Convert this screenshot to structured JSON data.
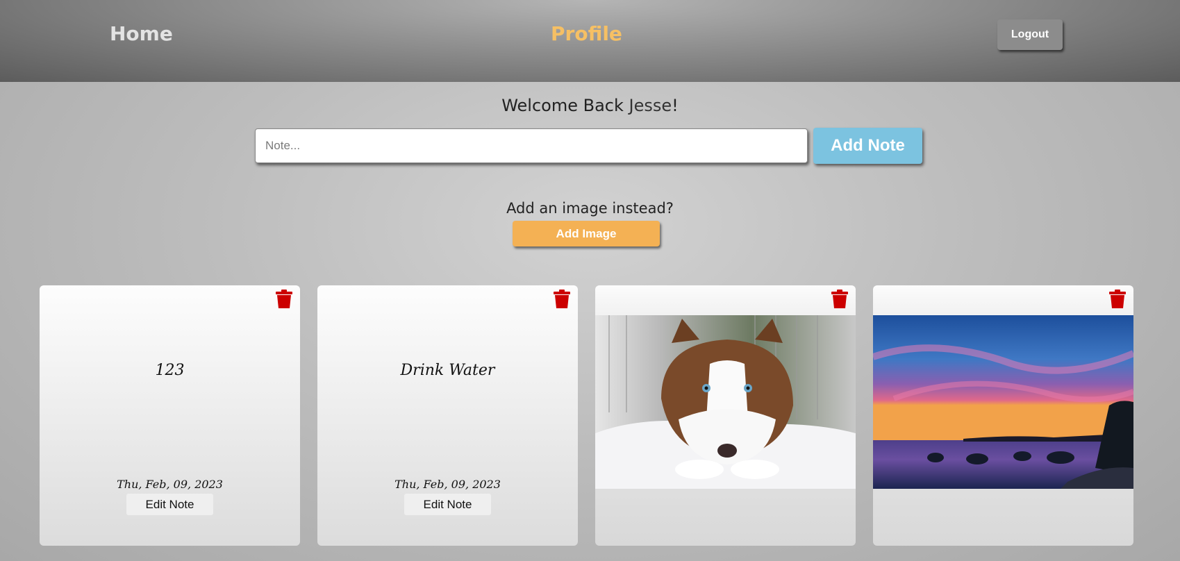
{
  "nav": {
    "home": "Home",
    "profile": "Profile",
    "logout": "Logout"
  },
  "welcome": {
    "greeting": "Welcome Back",
    "user": "Jesse",
    "suffix": "!"
  },
  "note_form": {
    "placeholder": "Note...",
    "submit": "Add Note"
  },
  "image_form": {
    "prompt": "Add an image instead?",
    "submit": "Add Image"
  },
  "cards": [
    {
      "type": "note",
      "text": "123",
      "date": "Thu, Feb, 09, 2023",
      "edit": "Edit Note"
    },
    {
      "type": "note",
      "text": "Drink Water",
      "date": "Thu, Feb, 09, 2023",
      "edit": "Edit Note"
    },
    {
      "type": "image",
      "content": "husky lying in snow photo"
    },
    {
      "type": "image",
      "content": "sunset over lake photo"
    }
  ],
  "colors": {
    "profile_accent": "#f6c064",
    "add_note": "#7cc3e0",
    "add_image": "#f4b154",
    "trash": "#cc0000"
  }
}
